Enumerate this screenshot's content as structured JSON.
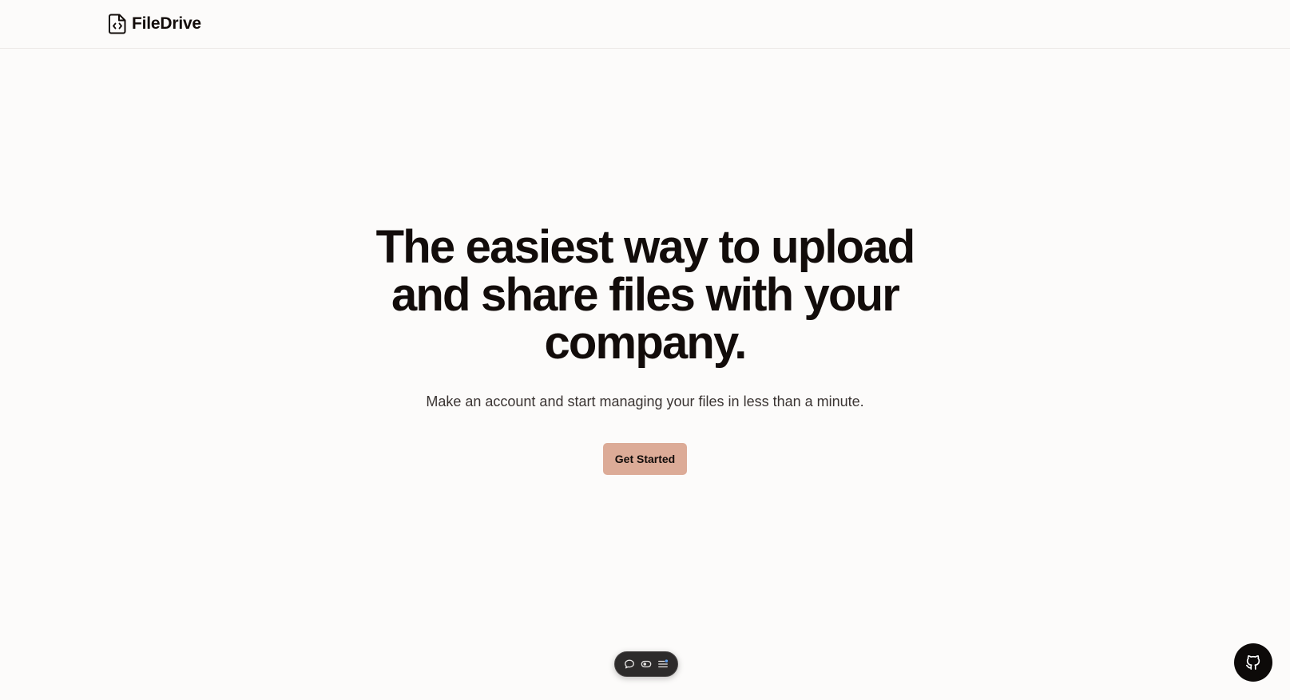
{
  "header": {
    "brand_name": "FileDrive",
    "brand_icon": "file-code-icon"
  },
  "hero": {
    "title": "The easiest way to upload and share files with your company.",
    "subtitle": "Make an account and start managing your files in less than a minute.",
    "cta_label": "Get Started"
  },
  "dev_toolbar": {
    "icons": [
      "chat-bubble-icon",
      "toggle-icon",
      "list-icon"
    ]
  },
  "github_button": {
    "icon": "github-icon"
  },
  "colors": {
    "background": "#fcfbfa",
    "text": "#120c0a",
    "accent": "#dcab97",
    "toolbar": "#2d2b2b"
  }
}
